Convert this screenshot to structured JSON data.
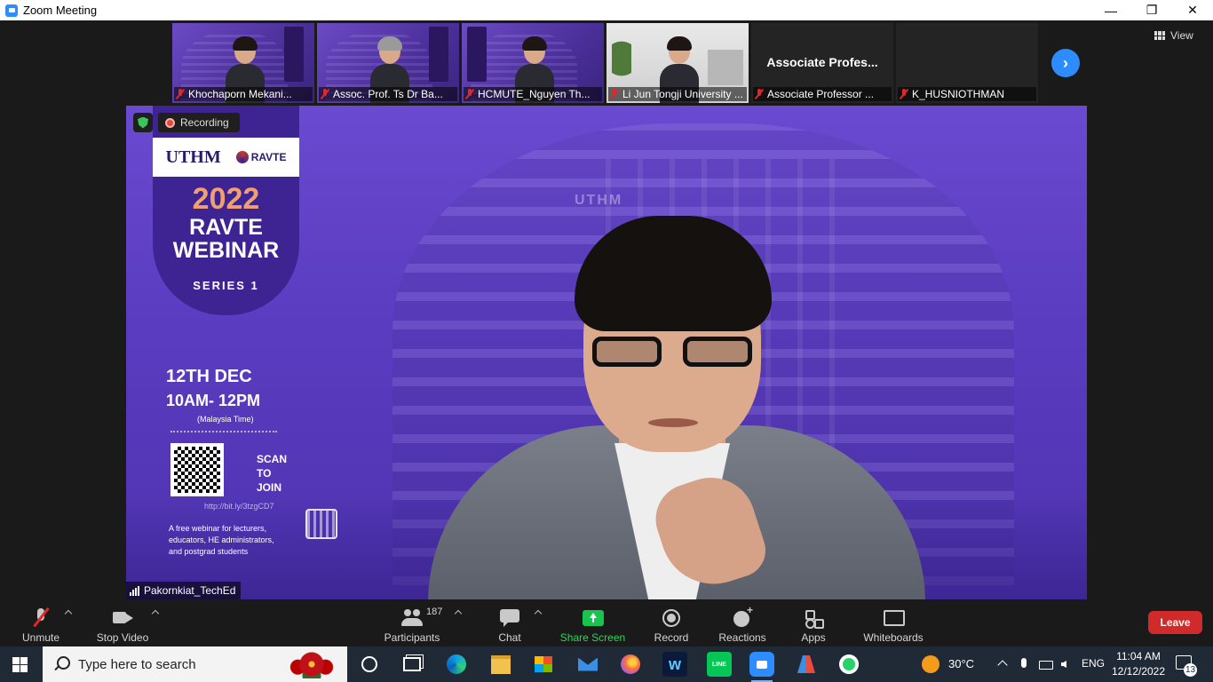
{
  "window": {
    "title": "Zoom Meeting",
    "minimize": "—",
    "maximize": "❐",
    "close": "✕"
  },
  "strip": {
    "view_label": "View",
    "tiles": [
      {
        "name": "Khochaporn Mekani...",
        "muted": true,
        "type": "poster"
      },
      {
        "name": "Assoc. Prof. Ts Dr Ba...",
        "muted": true,
        "type": "poster"
      },
      {
        "name": "HCMUTE_Nguyen Th...",
        "muted": true,
        "type": "poster"
      },
      {
        "name": "Li Jun Tongji University ...",
        "muted": true,
        "type": "office"
      },
      {
        "name": "Associate Professor ...",
        "muted": true,
        "type": "blank",
        "display_name": "Associate Profes..."
      },
      {
        "name": "K_HUSNIOTHMAN",
        "muted": true,
        "type": "blank"
      }
    ]
  },
  "speaker": {
    "recording_label": "Recording",
    "name": "Pakornkiat_TechEd",
    "sign_text": "UTHM",
    "poster": {
      "logo_left": "UTHM",
      "logo_right": "RAVTE",
      "year": "2022",
      "title_line1": "RAVTE",
      "title_line2": "WEBINAR",
      "series": "SERIES 1",
      "date": "12TH DEC",
      "time": "10AM- 12PM",
      "timezone": "(Malaysia Time)",
      "scan": "SCAN TO JOIN",
      "link": "http://bit.ly/3tzgCD7",
      "description": "A free webinar for lecturers, educators, HE administrators, and postgrad students"
    }
  },
  "toolbar": {
    "unmute": "Unmute",
    "stop_video": "Stop Video",
    "participants": "Participants",
    "participants_count": "187",
    "chat": "Chat",
    "share_screen": "Share Screen",
    "record": "Record",
    "reactions": "Reactions",
    "apps": "Apps",
    "whiteboards": "Whiteboards",
    "leave": "Leave",
    "share_color": "#18c350",
    "leave_color": "#d02a2a"
  },
  "taskbar": {
    "search_placeholder": "Type here to search",
    "temperature": "30°C",
    "language": "ENG",
    "time": "11:04 AM",
    "date": "12/12/2022",
    "notification_count": "13"
  }
}
